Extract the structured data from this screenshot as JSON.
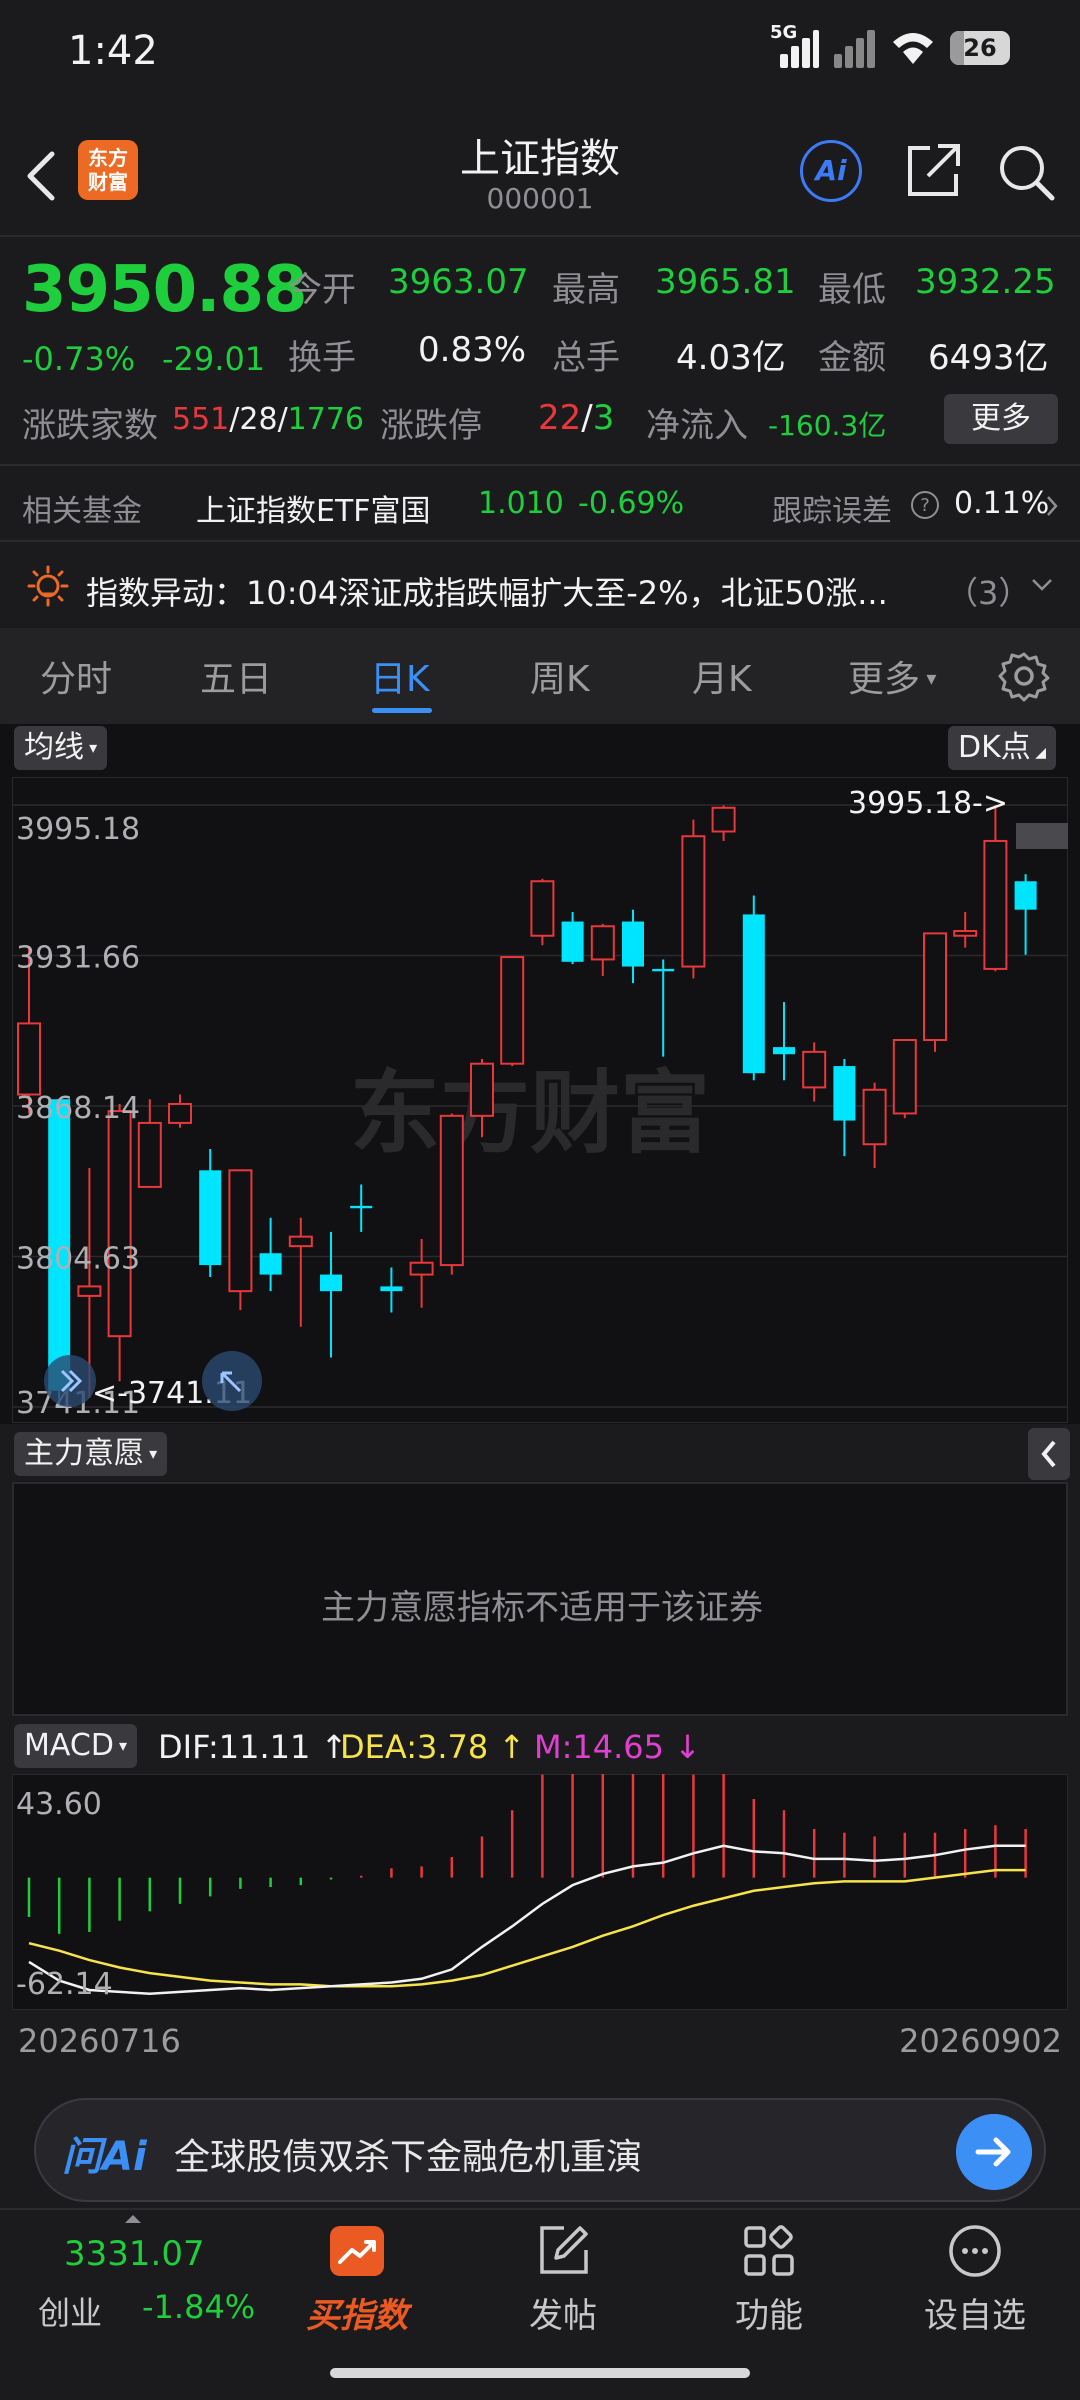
{
  "status_bar": {
    "time": "1:42",
    "network": "5G",
    "battery": "26"
  },
  "header": {
    "title": "上证指数",
    "code": "000001",
    "logo_text": "东方财富",
    "ai_label": "Ai"
  },
  "quote": {
    "price": "3950.88",
    "change_pct": "-0.73%",
    "change_abs": "-29.01",
    "open_label": "今开",
    "open": "3963.07",
    "high_label": "最高",
    "high": "3965.81",
    "low_label": "最低",
    "low": "3932.25",
    "turnover_label": "换手",
    "turnover": "0.83%",
    "volume_label": "总手",
    "volume": "4.03亿",
    "amount_label": "金额",
    "amount": "6493亿",
    "breadth_label": "涨跌家数",
    "breadth_up": "551",
    "breadth_flat": "28",
    "breadth_down": "1776",
    "limit_label": "涨跌停",
    "limit_up": "22",
    "limit_down": "3",
    "netflow_label": "净流入",
    "netflow": "-160.3亿",
    "more_label": "更多"
  },
  "fund": {
    "label": "相关基金",
    "name": "上证指数ETF富国",
    "price": "1.010",
    "change": "-0.69%",
    "track_label": "跟踪误差",
    "track_value": "0.11%"
  },
  "alert": {
    "text": "指数异动：10:04深证成指跌幅扩大至-2%，北证50涨...",
    "count": "（3）"
  },
  "tabs": [
    {
      "label": "分时"
    },
    {
      "label": "五日"
    },
    {
      "label": "日K"
    },
    {
      "label": "周K"
    },
    {
      "label": "月K"
    },
    {
      "label": "更多"
    }
  ],
  "kchart": {
    "ma_label": "均线",
    "dk_label": "DK点",
    "watermark": "东方财富",
    "y_ticks": [
      "3995.18",
      "3931.66",
      "3868.14",
      "3804.63",
      "3741.11"
    ],
    "max_marker": "3995.18->",
    "min_marker": "<-3741.11"
  },
  "chart_data": [
    {
      "type": "candlestick",
      "title": "日K",
      "ylim": [
        3741.11,
        3995.18
      ],
      "candles": [
        {
          "o": 3873,
          "c": 3903,
          "h": 3935,
          "l": 3865
        },
        {
          "o": 3871,
          "c": 3748,
          "h": 3871,
          "l": 3741
        },
        {
          "o": 3788,
          "c": 3792,
          "h": 3842,
          "l": 3745
        },
        {
          "o": 3771,
          "c": 3866,
          "h": 3869,
          "l": 3752
        },
        {
          "o": 3834,
          "c": 3861,
          "h": 3871,
          "l": 3834
        },
        {
          "o": 3861,
          "c": 3869,
          "h": 3873,
          "l": 3859
        },
        {
          "o": 3841,
          "c": 3801,
          "h": 3850,
          "l": 3796
        },
        {
          "o": 3790,
          "c": 3841,
          "h": 3841,
          "l": 3782
        },
        {
          "o": 3806,
          "c": 3797,
          "h": 3821,
          "l": 3790
        },
        {
          "o": 3809,
          "c": 3813,
          "h": 3821,
          "l": 3775
        },
        {
          "o": 3797,
          "c": 3790,
          "h": 3815,
          "l": 3762
        },
        {
          "o": 3826,
          "c": 3825,
          "h": 3835,
          "l": 3815
        },
        {
          "o": 3792,
          "c": 3790,
          "h": 3800,
          "l": 3781
        },
        {
          "o": 3797,
          "c": 3802,
          "h": 3812,
          "l": 3783
        },
        {
          "o": 3801,
          "c": 3864,
          "h": 3865,
          "l": 3797
        },
        {
          "o": 3864,
          "c": 3886,
          "h": 3888,
          "l": 3855
        },
        {
          "o": 3886,
          "c": 3931,
          "h": 3931,
          "l": 3885
        },
        {
          "o": 3940,
          "c": 3963,
          "h": 3964,
          "l": 3936
        },
        {
          "o": 3946,
          "c": 3929,
          "h": 3950,
          "l": 3928
        },
        {
          "o": 3930,
          "c": 3944,
          "h": 3945,
          "l": 3923
        },
        {
          "o": 3946,
          "c": 3927,
          "h": 3951,
          "l": 3920
        },
        {
          "o": 3926,
          "c": 3925,
          "h": 3930,
          "l": 3889
        },
        {
          "o": 3927,
          "c": 3982,
          "h": 3989,
          "l": 3922
        },
        {
          "o": 3984,
          "c": 3994,
          "h": 3995,
          "l": 3980
        },
        {
          "o": 3949,
          "c": 3882,
          "h": 3957,
          "l": 3879
        },
        {
          "o": 3893,
          "c": 3890,
          "h": 3912,
          "l": 3879
        },
        {
          "o": 3876,
          "c": 3891,
          "h": 3895,
          "l": 3870
        },
        {
          "o": 3885,
          "c": 3862,
          "h": 3888,
          "l": 3847
        },
        {
          "o": 3852,
          "c": 3875,
          "h": 3878,
          "l": 3842
        },
        {
          "o": 3865,
          "c": 3896,
          "h": 3896,
          "l": 3863
        },
        {
          "o": 3896,
          "c": 3941,
          "h": 3941,
          "l": 3891
        },
        {
          "o": 3940,
          "c": 3942,
          "h": 3950,
          "l": 3935
        },
        {
          "o": 3926,
          "c": 3980,
          "h": 3995,
          "l": 3925
        },
        {
          "o": 3963,
          "c": 3951,
          "h": 3966,
          "l": 3932
        }
      ]
    },
    {
      "type": "macd",
      "title": "MACD",
      "ylim": [
        -62.14,
        43.6
      ],
      "dif_label": "DIF:11.11",
      "dea_label": "DEA:3.78",
      "m_label": "M:14.65",
      "dif": [
        -45,
        -55,
        -60,
        -61,
        -62,
        -61,
        -60,
        -59,
        -60,
        -59,
        -58,
        -57,
        -56,
        -54,
        -49,
        -37,
        -26,
        -14,
        -4,
        2,
        6,
        8,
        13,
        17,
        14,
        13,
        10,
        10,
        9,
        10,
        12,
        15,
        17,
        17
      ],
      "dea": [
        -35,
        -39,
        -44,
        -48,
        -51,
        -53,
        -55,
        -56,
        -57,
        -57,
        -58,
        -58,
        -58,
        -57,
        -55,
        -52,
        -47,
        -42,
        -37,
        -31,
        -26,
        -20,
        -15,
        -11,
        -7,
        -5,
        -3,
        -2,
        -2,
        -2,
        0,
        2,
        4,
        4
      ],
      "m": [
        -21,
        -30,
        -29,
        -23,
        -18,
        -14,
        -10,
        -6,
        -5,
        -4,
        -1,
        1,
        5,
        6,
        11,
        22,
        36,
        55,
        64,
        65,
        64,
        56,
        55,
        56,
        42,
        36,
        26,
        24,
        22,
        24,
        24,
        26,
        28,
        26
      ],
      "x_start": "20260716",
      "x_end": "20260902"
    }
  ],
  "zl": {
    "label": "主力意愿",
    "message": "主力意愿指标不适用于该证券"
  },
  "macd": {
    "label": "MACD",
    "dif": "DIF:11.11",
    "dea": "DEA:3.78",
    "m": "M:14.65",
    "y_top": "43.60",
    "y_bottom": "-62.14"
  },
  "dates": {
    "start": "20260716",
    "end": "20260902"
  },
  "ask": {
    "logo": "问Ai",
    "text": "全球股债双杀下金融危机重演"
  },
  "nav": {
    "index_price": "3331.07",
    "index_name": "创业",
    "index_change": "-1.84%",
    "items": [
      {
        "label": "买指数"
      },
      {
        "label": "发帖"
      },
      {
        "label": "功能"
      },
      {
        "label": "设自选"
      }
    ]
  },
  "colors": {
    "up": "#e8383b",
    "down": "#00e5ff",
    "green": "#1fce3c",
    "accent": "#3c8ff5"
  }
}
